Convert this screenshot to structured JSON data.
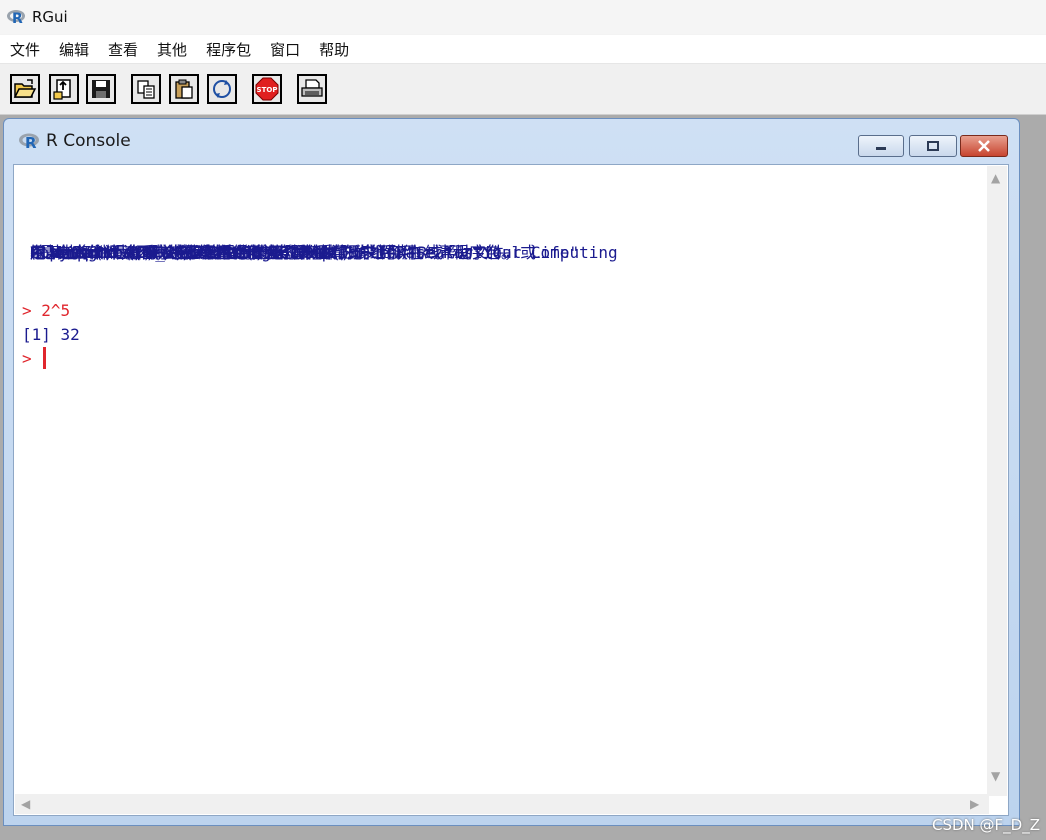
{
  "app": {
    "title": "RGui"
  },
  "menu": [
    {
      "label": "文件"
    },
    {
      "label": "编辑"
    },
    {
      "label": "查看"
    },
    {
      "label": "其他"
    },
    {
      "label": "程序包"
    },
    {
      "label": "窗口"
    },
    {
      "label": "帮助"
    }
  ],
  "toolbar": {
    "icons": [
      "open-script-icon",
      "load-workspace-icon",
      "save-icon",
      "copy-icon",
      "paste-icon",
      "refresh-icon",
      "stop-icon",
      "print-icon"
    ],
    "stop_label": "STOP"
  },
  "console": {
    "title": "R Console",
    "lines": [
      {
        "text": "R version 4.4.1 (2024-06-14 ucrt) -- \"Race for Your Life\"",
        "kind": "output"
      },
      {
        "text": "Copyright (C) 2024 The R Foundation for Statistical Computing",
        "kind": "output"
      },
      {
        "text": "Platform: x86_64-w64-mingw32/x64",
        "kind": "output"
      },
      {
        "text": "",
        "kind": "blank"
      },
      {
        "text": "R是自由软件，不附带任何担保。",
        "kind": "output"
      },
      {
        "text": "在某些条件下你可以将其自由分发。",
        "kind": "output"
      },
      {
        "text": "用'license()'或'licence()'来看分发的详细条件。",
        "kind": "output"
      },
      {
        "text": "",
        "kind": "blank"
      },
      {
        "text": "R是个合作计划，有许多人为之做出了贡献.",
        "kind": "output"
      },
      {
        "text": "用'contributors()'来看合著者的详细情况",
        "kind": "output"
      },
      {
        "text": "用'citation()'会告诉你如何在出版物中正确地引用R或R程序包。",
        "kind": "output"
      },
      {
        "text": "",
        "kind": "blank"
      },
      {
        "text": "用'demo()'来看一些示例程序，用'help()'来阅读在线帮助文件，或",
        "kind": "output"
      },
      {
        "text": "用'help.start()'通过HTML浏览器来看帮助文件。",
        "kind": "output"
      },
      {
        "text": "输入'q()'退出R.",
        "kind": "output"
      },
      {
        "text": "",
        "kind": "blank"
      },
      {
        "text": "> 2^5",
        "kind": "cmd"
      },
      {
        "text": "[1] 32",
        "kind": "result"
      }
    ],
    "prompt": "> "
  },
  "colors": {
    "command": "#e0262d",
    "output": "#1b1b8f"
  },
  "watermark": "CSDN @F_D_Z"
}
